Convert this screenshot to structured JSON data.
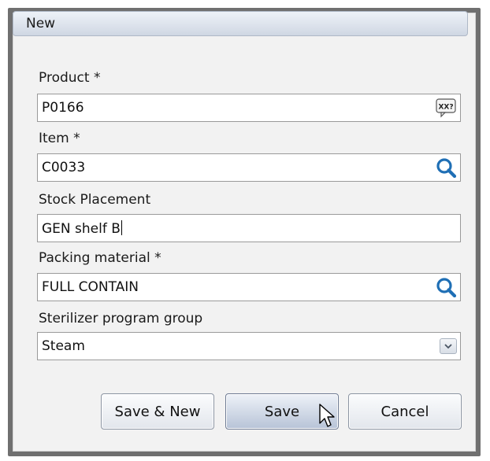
{
  "dialog": {
    "title": "New"
  },
  "fields": {
    "product": {
      "label": "Product *",
      "value": "P0166",
      "icon": "xx-lookup-icon"
    },
    "item": {
      "label": "Item *",
      "value": "C0033",
      "icon": "search-icon"
    },
    "stock_placement": {
      "label": "Stock Placement",
      "value": "GEN shelf B"
    },
    "packing_material": {
      "label": "Packing material *",
      "value": "FULL CONTAIN",
      "icon": "search-icon"
    },
    "sterilizer_program_group": {
      "label": "Sterilizer program group",
      "value": "Steam",
      "icon": "chevron-down-icon"
    }
  },
  "buttons": {
    "save_new": "Save & New",
    "save": "Save",
    "cancel": "Cancel"
  },
  "colors": {
    "accent": "#1f6fb5",
    "panel": "#f2f2f2",
    "frame": "#707070"
  }
}
